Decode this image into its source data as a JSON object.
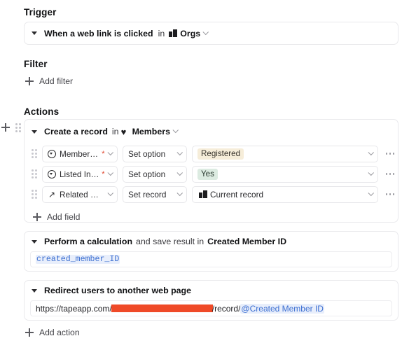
{
  "trigger": {
    "heading": "Trigger",
    "label": "When a web link is clicked",
    "connector": "in",
    "target": "Orgs",
    "target_icon": "building-icon"
  },
  "filter": {
    "heading": "Filter",
    "add_label": "Add filter"
  },
  "actions": {
    "heading": "Actions",
    "add_action_label": "Add action",
    "create_record": {
      "label": "Create a record",
      "connector": "in",
      "table": "Members",
      "table_icon": "heart-icon",
      "add_field_label": "Add field",
      "fields": [
        {
          "icon": "single-select-icon",
          "name": "Membershi...",
          "required": "*",
          "operation": "Set option",
          "value": "Registered",
          "value_style": "pill-cream",
          "value_icon": "",
          "menu": "more-options"
        },
        {
          "icon": "single-select-icon",
          "name": "Listed In Di...",
          "required": "*",
          "operation": "Set option",
          "value": "Yes",
          "value_style": "pill-green",
          "value_icon": "",
          "menu": "more-options"
        },
        {
          "icon": "link-arrow-icon",
          "name": "Related Org...",
          "required": "",
          "operation": "Set record",
          "value": "Current record",
          "value_style": "plain",
          "value_icon": "building-icon",
          "menu": "more-options"
        }
      ]
    },
    "calculation": {
      "label": "Perform a calculation",
      "connector": "and save result in",
      "target": "Created Member ID",
      "formula": "created_member_ID"
    },
    "redirect": {
      "label": "Redirect users to another web page",
      "url_prefix": "https://tapeapp.com/",
      "url_redacted": "",
      "url_suffix": "/record/",
      "url_token": "@Created Member ID"
    }
  },
  "colors": {
    "pill_cream_bg": "#f6edd9",
    "pill_cream_text": "#35312a",
    "pill_green_bg": "#dcebe1",
    "pill_green_text": "#2a3a30",
    "redaction": "#ef4a28",
    "token_text": "#3c6fd1",
    "token_bg": "#e8eefb",
    "card_border": "#e9e9ec"
  }
}
